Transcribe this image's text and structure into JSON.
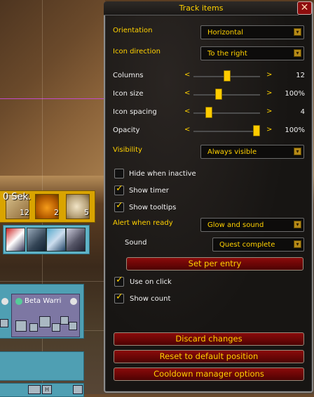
{
  "background": {
    "cooldown_text": "0 Sek.",
    "cooldown_counts": [
      "12",
      "2",
      "5"
    ],
    "unit_name": "Beta Warri",
    "mini_label": "H"
  },
  "dialog": {
    "title": "Track items",
    "close_symbol": "✕",
    "orientation": {
      "label": "Orientation",
      "value": "Horizontal"
    },
    "icon_direction": {
      "label": "Icon direction",
      "value": "To the right"
    },
    "sliders": [
      {
        "label": "Columns",
        "value": "12",
        "position": 0.5
      },
      {
        "label": "Icon size",
        "value": "100%",
        "position": 0.37
      },
      {
        "label": "Icon spacing",
        "value": "4",
        "position": 0.2
      },
      {
        "label": "Opacity",
        "value": "100%",
        "position": 1.0
      }
    ],
    "slider_left": "<",
    "slider_right": ">",
    "visibility": {
      "label": "Visibility",
      "value": "Always visible"
    },
    "checks": {
      "hide_when_inactive": {
        "label": "Hide when inactive",
        "checked": false
      },
      "show_timer": {
        "label": "Show timer",
        "checked": true
      },
      "show_tooltips": {
        "label": "Show tooltips",
        "checked": true
      }
    },
    "alert": {
      "label": "Alert when ready",
      "value": "Glow and sound"
    },
    "sound": {
      "label": "Sound",
      "value": "Quest complete"
    },
    "set_per_entry": "Set per entry",
    "use_on_click": {
      "label": "Use on click",
      "checked": true
    },
    "show_count": {
      "label": "Show count",
      "checked": true
    },
    "buttons": {
      "discard": "Discard changes",
      "reset": "Reset to default position",
      "cooldown_manager": "Cooldown manager options"
    }
  },
  "colors": {
    "accent_gold": "#ffd100",
    "button_red": "#8a0b0b",
    "dialog_bg": "#151312"
  }
}
